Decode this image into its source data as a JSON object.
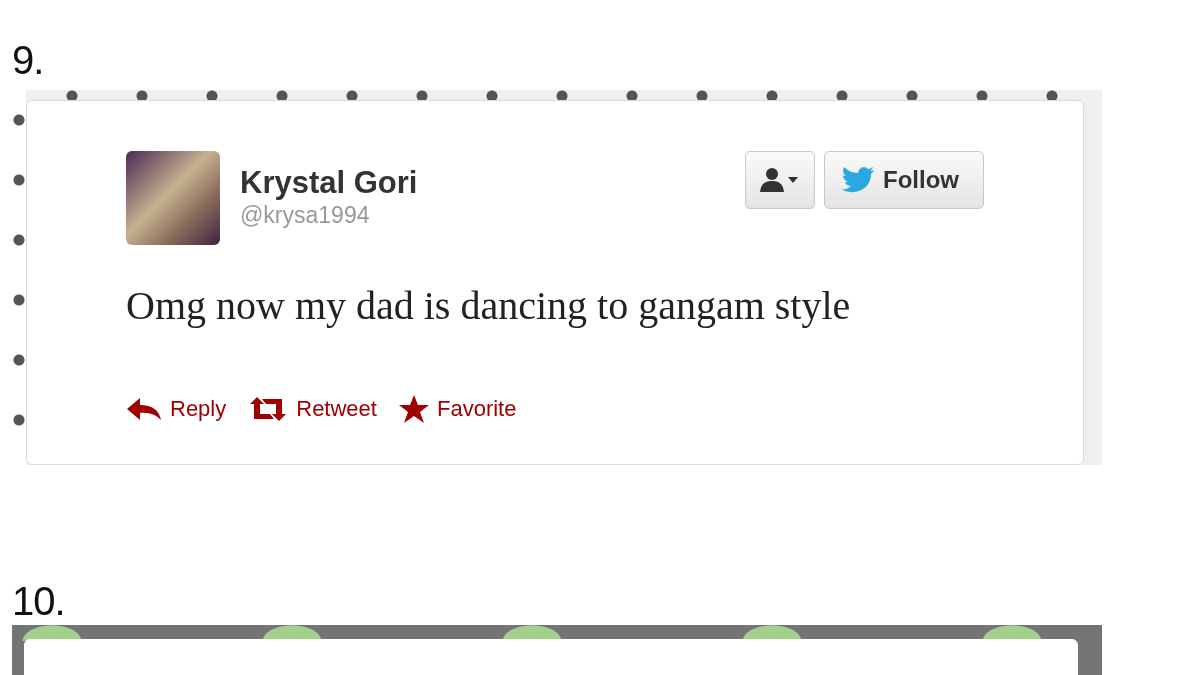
{
  "entries": [
    {
      "number": "9.",
      "kind": "floral",
      "tweet": {
        "name": "Krystal Gori",
        "handle": "@krysa1994",
        "follow_label": "Follow",
        "text": "Omg now my dad is dancing to gangam style",
        "actions": [
          {
            "kind": "reply",
            "label": "Reply"
          },
          {
            "kind": "retweet",
            "label": "Retweet"
          },
          {
            "kind": "favorite",
            "label": "Favorite"
          }
        ]
      }
    },
    {
      "number": "10.",
      "kind": "clouds"
    }
  ]
}
